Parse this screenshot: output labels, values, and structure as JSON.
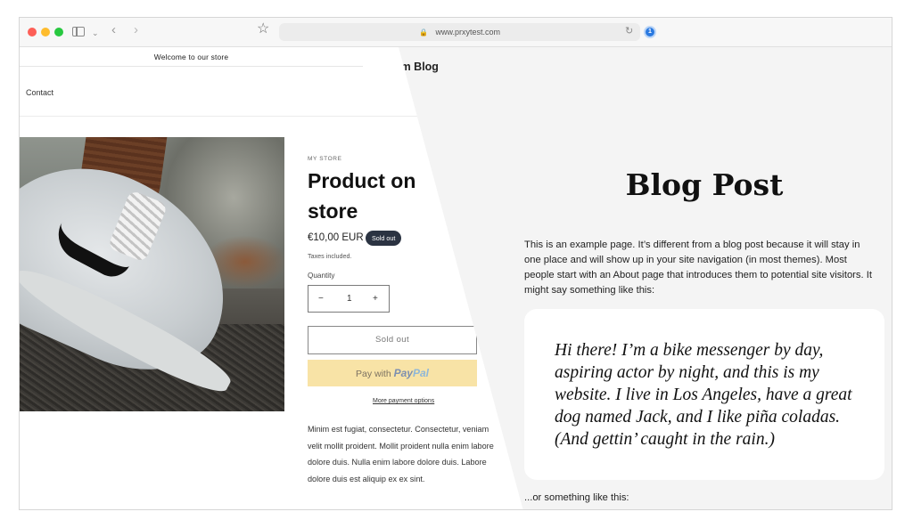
{
  "browser": {
    "url": "www.prxytest.com"
  },
  "blog": {
    "site_title": "com Blog",
    "post_title": "Blog Post",
    "intro": "This is an example page. It’s different from a blog post because it will stay in one place and will show up in your site navigation (in most themes). Most people start with an About page that introduces them to potential site visitors. It might say something like this:",
    "quote": "Hi there! I’m a bike messenger by day, aspiring actor by night, and this is my website. I live in Los Angeles, have a great dog named Jack, and I like piña coladas. (And gettin’ caught in the rain.)",
    "outro": "...or something like this:"
  },
  "store": {
    "announcement": "Welcome to our store",
    "nav_contact": "Contact",
    "vendor": "MY STORE",
    "product_title": "Product on store",
    "price": "€10,00 EUR",
    "badge": "Sold out",
    "taxes_note": "Taxes included.",
    "quantity_label": "Quantity",
    "quantity_minus": "−",
    "quantity_value": "1",
    "quantity_plus": "+",
    "sold_out_button": "Sold out",
    "paypal_prefix": "Pay with",
    "paypal_brand_1": "Pay",
    "paypal_brand_2": "Pal",
    "more_payment": "More payment options",
    "description": "Minim est fugiat, consectetur. Consectetur, veniam velit mollit proident. Mollit proident nulla enim labore dolore duis. Nulla enim labore dolore duis. Labore dolore duis est aliquip ex ex sint."
  }
}
